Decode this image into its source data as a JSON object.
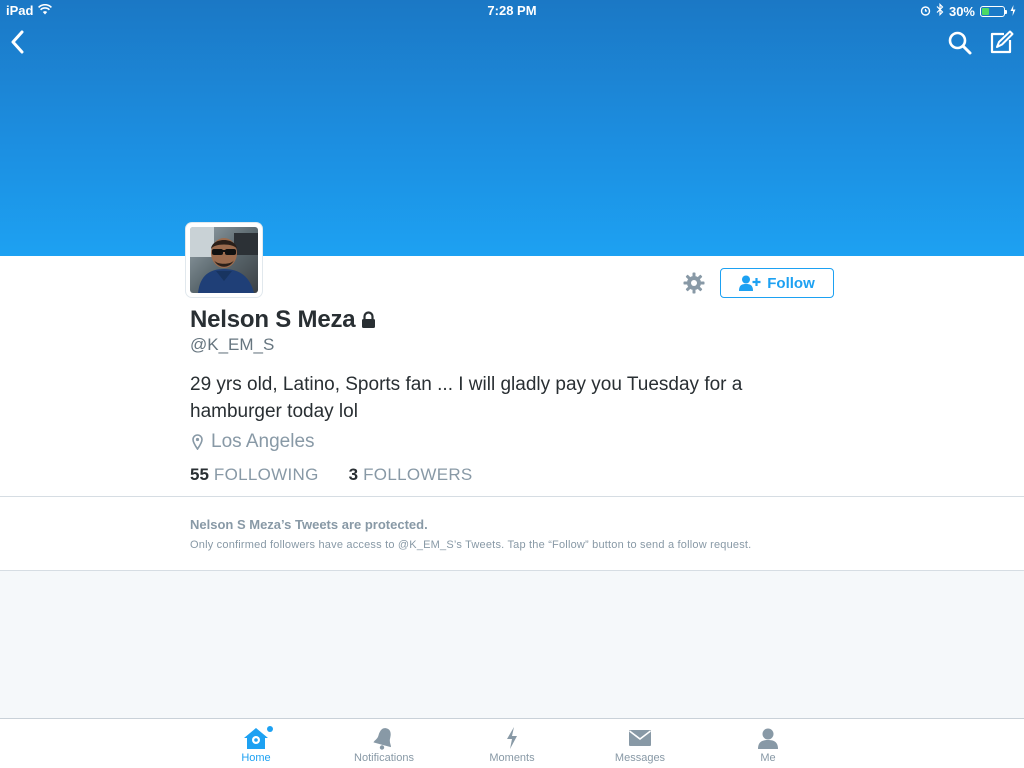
{
  "status_bar": {
    "device": "iPad",
    "time": "7:28 PM",
    "battery": "30%"
  },
  "header": {
    "back_icon": "chevron-left-icon",
    "search_icon": "search-icon",
    "compose_icon": "compose-icon"
  },
  "profile": {
    "name": "Nelson S Meza",
    "handle": "@K_EM_S",
    "bio": "29 yrs old, Latino, Sports fan ... I will gladly pay you Tuesday for a hamburger today lol",
    "location": "Los Angeles",
    "following_count": "55",
    "following_label": "FOLLOWING",
    "followers_count": "3",
    "followers_label": "FOLLOWERS",
    "follow_button": "Follow"
  },
  "protected_notice": {
    "title": "Nelson S Meza’s Tweets are protected.",
    "description": "Only confirmed followers have access to @K_EM_S’s Tweets. Tap the “Follow” button to send a follow request."
  },
  "tabbar": {
    "items": [
      {
        "label": "Home",
        "icon": "home-icon",
        "active": true
      },
      {
        "label": "Notifications",
        "icon": "bell-icon",
        "active": false
      },
      {
        "label": "Moments",
        "icon": "lightning-icon",
        "active": false
      },
      {
        "label": "Messages",
        "icon": "envelope-icon",
        "active": false
      },
      {
        "label": "Me",
        "icon": "person-icon",
        "active": false
      }
    ]
  },
  "colors": {
    "brand": "#1da1f2",
    "banner_top": "#1b78c5",
    "muted_text": "#8899a6",
    "battery_fill": "#4cd964"
  }
}
